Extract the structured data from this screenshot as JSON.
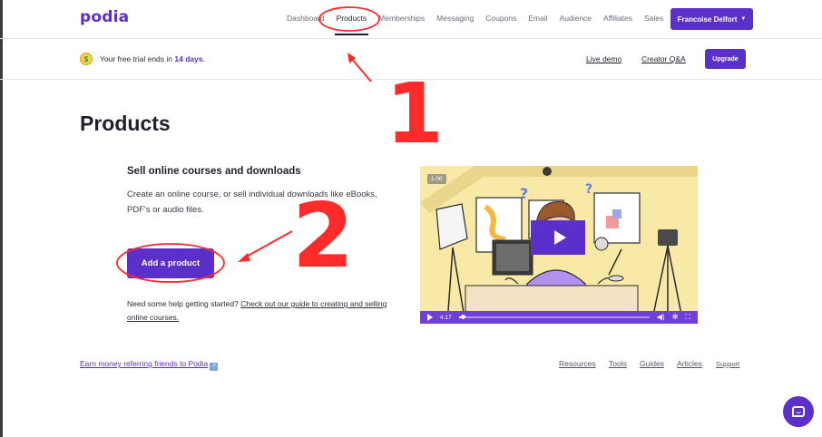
{
  "header": {
    "logo": "podia",
    "nav": [
      "Dashboard",
      "Products",
      "Memberships",
      "Messaging",
      "Coupons",
      "Email",
      "Audience",
      "Affiliates",
      "Sales"
    ],
    "active_nav": "Products",
    "user_menu": "Francoise Delfort"
  },
  "trial_banner": {
    "text_before": "Your free trial ends in ",
    "days": "14 days",
    "text_after": ".",
    "live_demo": "Live demo",
    "creator_qa": "Creator Q&A",
    "upgrade": "Upgrade"
  },
  "main": {
    "title": "Products",
    "heading": "Sell online courses and downloads",
    "description": "Create an online course, or sell individual downloads like eBooks, PDF's or audio files.",
    "add_button": "Add a product",
    "help_prefix": "Need some help getting started? ",
    "help_link": "Check out our guide to creating and selling online courses."
  },
  "video": {
    "speed": "1.00",
    "time": "4:17",
    "progress": 0.02
  },
  "footer": {
    "refer": "Earn money referring friends to Podia",
    "links": [
      "Resources",
      "Tools",
      "Guides",
      "Articles",
      "Support"
    ]
  },
  "annotations": {
    "step1": "1",
    "step2": "2",
    "color": "#ff2a2a"
  },
  "colors": {
    "brand": "#5b2fc9"
  }
}
